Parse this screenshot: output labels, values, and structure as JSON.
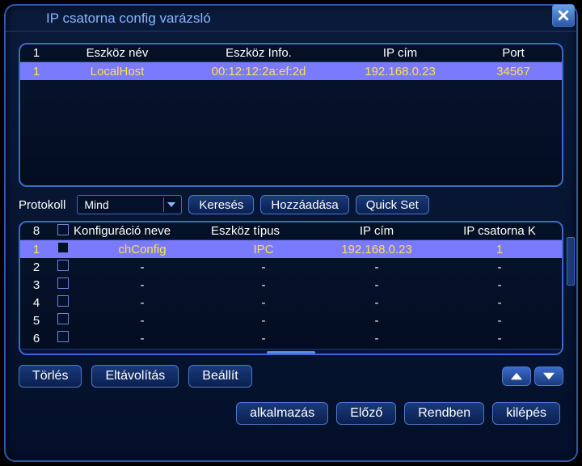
{
  "window": {
    "title": "IP csatorna config varázsló"
  },
  "table1": {
    "headers": {
      "idx": "1",
      "name": "Eszköz név",
      "info": "Eszköz Info.",
      "ip": "IP cím",
      "port": "Port"
    },
    "rows": [
      {
        "idx": "1",
        "name": "LocalHost",
        "info": "00:12:12:2a:ef:2d",
        "ip": "192.168.0.23",
        "port": "34567"
      }
    ]
  },
  "protocol": {
    "label": "Protokoll",
    "value": "Mind",
    "search": "Keresés",
    "add": "Hozzáadása",
    "quickset": "Quick Set"
  },
  "table2": {
    "headers": {
      "idx": "8",
      "name": "Konfiguráció neve",
      "type": "Eszköz típus",
      "ip": "IP cím",
      "ch": "IP csatorna K"
    },
    "rows": [
      {
        "idx": "1",
        "name": "chConfig",
        "type": "IPC",
        "ip": "192.168.0.23",
        "ch": "1",
        "sel": true
      },
      {
        "idx": "2",
        "name": "-",
        "type": "-",
        "ip": "-",
        "ch": "-"
      },
      {
        "idx": "3",
        "name": "-",
        "type": "-",
        "ip": "-",
        "ch": "-"
      },
      {
        "idx": "4",
        "name": "-",
        "type": "-",
        "ip": "-",
        "ch": "-"
      },
      {
        "idx": "5",
        "name": "-",
        "type": "-",
        "ip": "-",
        "ch": "-"
      },
      {
        "idx": "6",
        "name": "-",
        "type": "-",
        "ip": "-",
        "ch": "-"
      }
    ]
  },
  "actions": {
    "delete": "Törlés",
    "remove": "Eltávolítás",
    "set": "Beállít"
  },
  "footer": {
    "apply": "alkalmazás",
    "prev": "Előző",
    "ok": "Rendben",
    "exit": "kilépés"
  }
}
